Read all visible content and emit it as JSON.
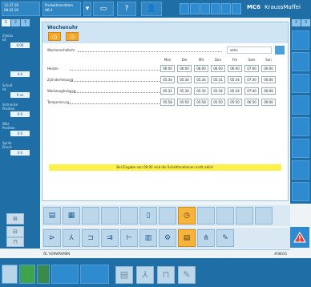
{
  "header": {
    "clock_line1": "12:37:18",
    "clock_line2": "08.02.18",
    "product_line1": "Produktionsdaten",
    "product_line2": "HB 4",
    "brand": "MC6",
    "user": "KraussMaffei"
  },
  "left": {
    "tabs": [
      "1",
      "2",
      "3"
    ],
    "fields": [
      {
        "label": "Zyklus",
        "sub": "Ist",
        "value": "0.00"
      },
      {
        "label": "",
        "sub": "",
        "value": "0.0"
      },
      {
        "label": "Schuß",
        "sub": "Ist",
        "value": "0 ns"
      },
      {
        "label": "Schnecke",
        "sub": "Position",
        "value": "0.0"
      },
      {
        "label": "Wkz",
        "sub": "Position",
        "value": "0.0"
      },
      {
        "label": "Spritz",
        "sub": "Druck",
        "value": "0.0"
      }
    ]
  },
  "right": {
    "tabs": [
      "2",
      "3"
    ]
  },
  "panel": {
    "title": "Wochenuhr",
    "mode_label": "Wochenschaltuhr",
    "mode_value": "aktiv",
    "days": [
      "Mon",
      "Die",
      "Mit",
      "Don",
      "Fre",
      "Sam",
      "Son"
    ],
    "rows": [
      {
        "label": "Heizen",
        "cells": [
          "06:00",
          "06:00",
          "06:00",
          "06:00",
          "06:00",
          "07:00",
          "00:00"
        ]
      },
      {
        "label": "Zylinderheizung",
        "cells": [
          "05:34",
          "05:34",
          "05:34",
          "05:31",
          "05:34",
          "07:30",
          "00:00"
        ]
      },
      {
        "label": "Werkzeugheizung",
        "cells": [
          "05:31",
          "05:34",
          "05:34",
          "05:34",
          "05:34",
          "07:40",
          "00:00"
        ]
      },
      {
        "label": "Temperierung",
        "cells": [
          "05:58",
          "05:50",
          "05:58",
          "05:50",
          "05:50",
          "06:50",
          "00:00"
        ]
      }
    ],
    "notice": "Bei Eingabe von 00:00 sind die Schaltfunktionen nicht aktiv!"
  },
  "status": {
    "left": "ÖL VORWÄRMEN",
    "right": "#08035"
  },
  "colors": {
    "accent": "#1f6fa6",
    "highlight": "#f6b43c",
    "notice": "#fff14a",
    "warning": "#e53935"
  }
}
